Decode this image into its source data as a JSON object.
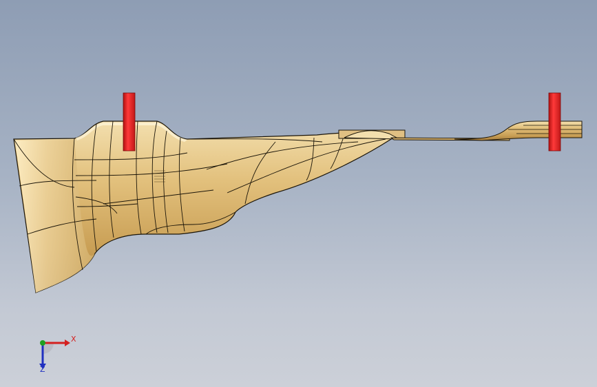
{
  "viewport": {
    "background_top": "#8e9db4",
    "background_bottom": "#ccd0d8"
  },
  "model": {
    "surface_color": "#e8c98a",
    "edge_color": "#1a1408",
    "pin_color": "#e02020"
  },
  "triad": {
    "x_label": "X",
    "z_label": "Z",
    "x_color": "#d42020",
    "y_color": "#20a020",
    "z_color": "#2030c0"
  }
}
